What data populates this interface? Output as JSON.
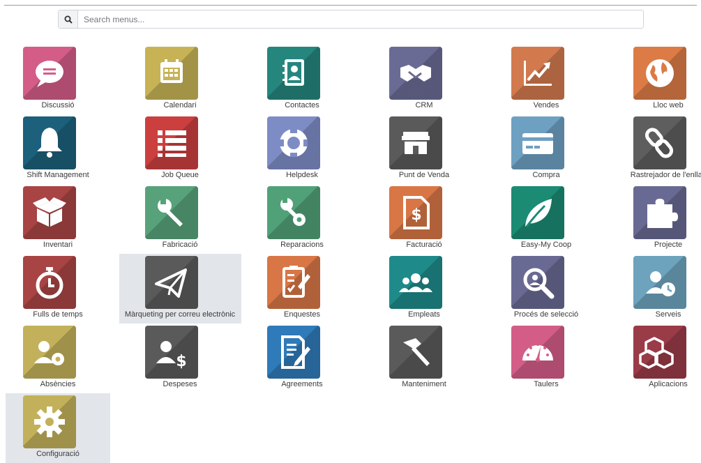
{
  "search": {
    "placeholder": "Search menus..."
  },
  "apps": [
    {
      "label": "Discussió",
      "icon": "chat-bubble-icon",
      "color": "#d35d87"
    },
    {
      "label": "Calendari",
      "icon": "calendar-icon",
      "color": "#c7b356"
    },
    {
      "label": "Contactes",
      "icon": "address-book-icon",
      "color": "#25867e"
    },
    {
      "label": "CRM",
      "icon": "handshake-icon",
      "color": "#6a6b94"
    },
    {
      "label": "Vendes",
      "icon": "line-chart-icon",
      "color": "#d27a4e"
    },
    {
      "label": "Lloc web",
      "icon": "globe-icon",
      "color": "#dc7b45"
    },
    {
      "label": "Shift Management",
      "icon": "bell-icon",
      "color": "#1c607b"
    },
    {
      "label": "Job Queue",
      "icon": "list-icon",
      "color": "#cc3f3f"
    },
    {
      "label": "Helpdesk",
      "icon": "life-ring-icon",
      "color": "#7e8cc5"
    },
    {
      "label": "Punt de Venda",
      "icon": "store-icon",
      "color": "#5a5a5a"
    },
    {
      "label": "Compra",
      "icon": "credit-card-icon",
      "color": "#6ea0c2"
    },
    {
      "label": "Rastrejador de l'enllaç",
      "icon": "link-icon",
      "color": "#5e5e5e"
    },
    {
      "label": "Inventari",
      "icon": "box-icon",
      "color": "#a94444"
    },
    {
      "label": "Fabricació",
      "icon": "wrench-icon",
      "color": "#57a27a"
    },
    {
      "label": "Reparacions",
      "icon": "wrench-gear-icon",
      "color": "#51a178"
    },
    {
      "label": "Facturació",
      "icon": "invoice-icon",
      "color": "#d87645"
    },
    {
      "label": "Easy-My Coop",
      "icon": "leaf-icon",
      "color": "#1b8b73"
    },
    {
      "label": "Projecte",
      "icon": "puzzle-icon",
      "color": "#696a93"
    },
    {
      "label": "Fulls de temps",
      "icon": "stopwatch-icon",
      "color": "#a94444"
    },
    {
      "label": "Màrqueting per correu electrònic",
      "icon": "paper-plane-icon",
      "color": "#5a5a5a"
    },
    {
      "label": "Enquestes",
      "icon": "clipboard-check-icon",
      "color": "#d87645"
    },
    {
      "label": "Empleats",
      "icon": "users-icon",
      "color": "#1e8a8a"
    },
    {
      "label": "Procés de selecció",
      "icon": "magnifier-icon",
      "color": "#696a93"
    },
    {
      "label": "Serveis",
      "icon": "user-clock-icon",
      "color": "#6da3bd"
    },
    {
      "label": "Absències",
      "icon": "user-gear-icon",
      "color": "#c2b15a"
    },
    {
      "label": "Despeses",
      "icon": "user-dollar-icon",
      "color": "#5a5a5a"
    },
    {
      "label": "Agreements",
      "icon": "document-pen-icon",
      "color": "#2f7ab8"
    },
    {
      "label": "Manteniment",
      "icon": "hammer-icon",
      "color": "#5a5a5a"
    },
    {
      "label": "Taulers",
      "icon": "gauge-icon",
      "color": "#d35d87"
    },
    {
      "label": "Aplicacions",
      "icon": "cubes-icon",
      "color": "#9a3b48"
    },
    {
      "label": "Configuració",
      "icon": "gear-icon",
      "color": "#c2b15a"
    }
  ]
}
